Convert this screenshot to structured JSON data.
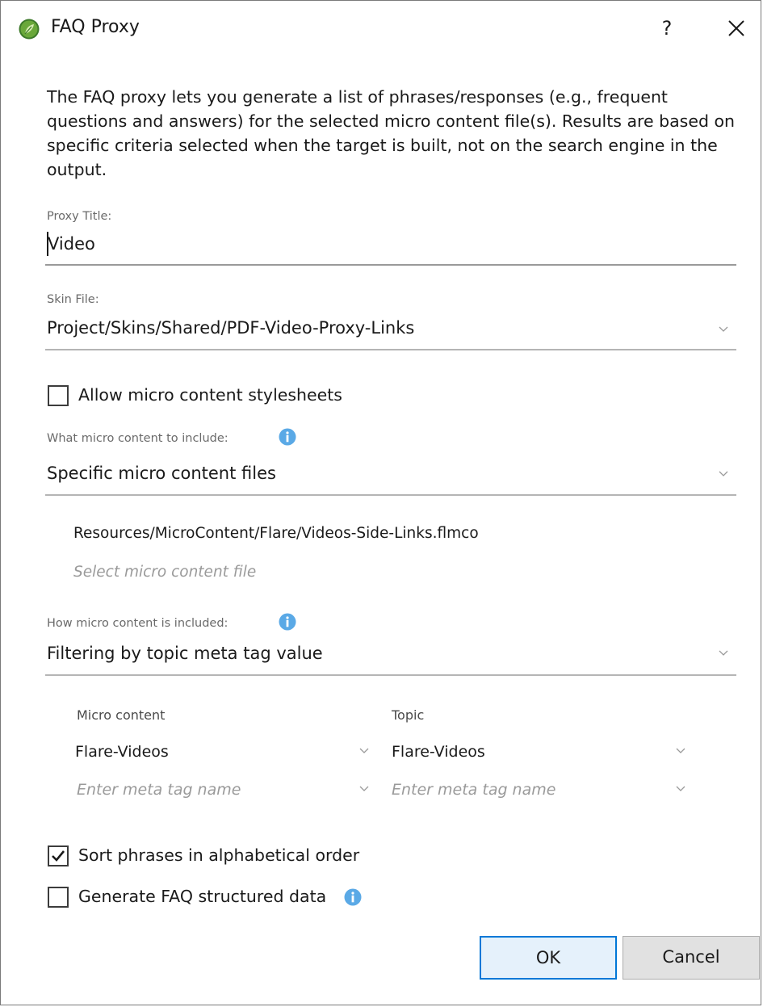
{
  "window": {
    "title": "FAQ Proxy",
    "help_label": "?"
  },
  "intro": "The FAQ proxy lets you generate a list of phrases/responses (e.g., frequent questions and answers) for the selected micro content file(s). Results are based on specific criteria selected when the target is built, not on the search engine in the output.",
  "proxy_title": {
    "label": "Proxy Title:",
    "value": "Video"
  },
  "skin_file": {
    "label": "Skin File:",
    "value": "Project/Skins/Shared/PDF-Video-Proxy-Links"
  },
  "allow_stylesheets": {
    "label": "Allow micro content stylesheets",
    "checked": false
  },
  "what_include": {
    "label": "What micro content to include:",
    "value": "Specific micro content files"
  },
  "micro_content_files": {
    "items": [
      "Resources/MicroContent/Flare/Videos-Side-Links.flmco"
    ],
    "placeholder": "Select micro content file"
  },
  "how_included": {
    "label": "How micro content is included:",
    "value": "Filtering by topic meta tag value"
  },
  "meta_tags": {
    "micro_content_header": "Micro content",
    "topic_header": "Topic",
    "micro_content_value": "Flare-Videos",
    "topic_value": "Flare-Videos",
    "micro_content_placeholder": "Enter meta tag name",
    "topic_placeholder": "Enter meta tag name"
  },
  "sort_alphabetical": {
    "label": "Sort phrases in alphabetical order",
    "checked": true
  },
  "generate_faq": {
    "label": "Generate FAQ structured data",
    "checked": false
  },
  "buttons": {
    "ok": "OK",
    "cancel": "Cancel"
  },
  "colors": {
    "accent": "#0078d7",
    "info_icon": "#5aa9e6",
    "app_icon": "#5f9c2f"
  }
}
